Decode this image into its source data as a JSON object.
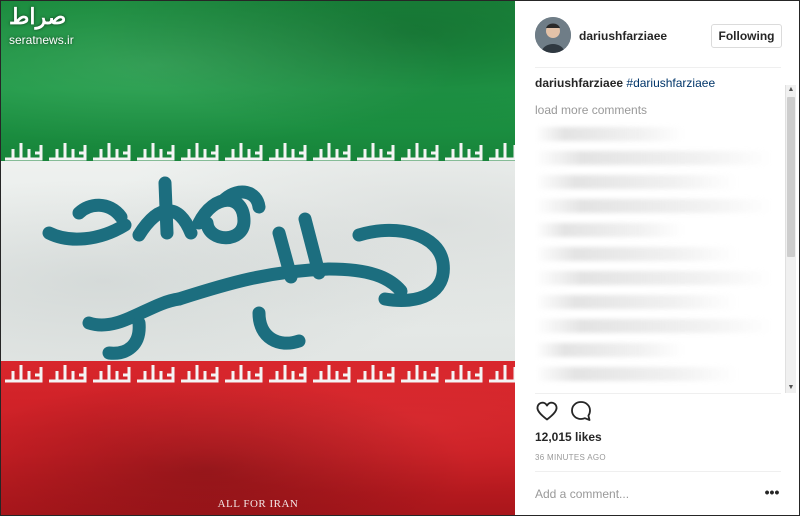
{
  "watermark": {
    "logo_text": "صراط",
    "site_url": "seratnews.ir"
  },
  "post_image": {
    "artwork_text": "درکنارهم میم",
    "footer_text": "ALL FOR IRAN",
    "takbir_text": "الله اکبر",
    "colors": {
      "green": "#1f9a47",
      "white": "#e8ebea",
      "red": "#d0222a",
      "calligraphy": "#1c6e7f"
    }
  },
  "header": {
    "username": "dariushfarziaee",
    "follow_label": "Following"
  },
  "caption": {
    "username": "dariushfarziaee",
    "hashtag": "#dariushfarziaee"
  },
  "comments": {
    "load_more_label": "load more comments"
  },
  "actions": {
    "like_icon": "heart-outline",
    "comment_icon": "speech-bubble-outline"
  },
  "likes_label": "12,015 likes",
  "timestamp": "36 MINUTES AGO",
  "comment_box": {
    "placeholder": "Add a comment...",
    "more_label": "•••"
  }
}
